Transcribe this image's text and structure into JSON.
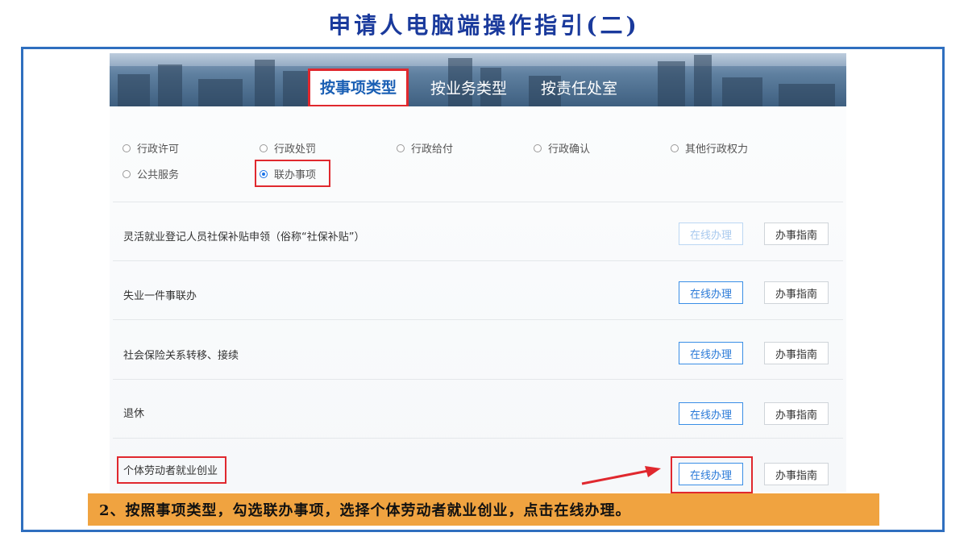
{
  "title": "申请人电脑端操作指引(二)",
  "tabs": [
    {
      "label": "按事项类型",
      "active": true
    },
    {
      "label": "按业务类型",
      "active": false
    },
    {
      "label": "按责任处室",
      "active": false
    }
  ],
  "radios": [
    {
      "label": "行政许可",
      "checked": false
    },
    {
      "label": "行政处罚",
      "checked": false
    },
    {
      "label": "行政给付",
      "checked": false
    },
    {
      "label": "行政确认",
      "checked": false
    },
    {
      "label": "其他行政权力",
      "checked": false
    },
    {
      "label": "公共服务",
      "checked": false
    },
    {
      "label": "联办事项",
      "checked": true
    }
  ],
  "items": [
    {
      "label": "灵活就业登记人员社保补贴申领（俗称“社保补贴”）",
      "online_label": "在线办理",
      "guide_label": "办事指南",
      "online_enabled": false
    },
    {
      "label": "失业一件事联办",
      "online_label": "在线办理",
      "guide_label": "办事指南",
      "online_enabled": true
    },
    {
      "label": "社会保险关系转移、接续",
      "online_label": "在线办理",
      "guide_label": "办事指南",
      "online_enabled": true
    },
    {
      "label": "退休",
      "online_label": "在线办理",
      "guide_label": "办事指南",
      "online_enabled": true
    },
    {
      "label": "个体劳动者就业创业",
      "online_label": "在线办理",
      "guide_label": "办事指南",
      "online_enabled": true
    }
  ],
  "instruction": "2、按照事项类型，勾选联办事项，选择个体劳动者就业创业，点击在线办理。",
  "colors": {
    "accent": "#1a5fb4",
    "highlight": "#e0282e",
    "instruction_bg": "#f0a340",
    "frame": "#2f6fbf"
  }
}
